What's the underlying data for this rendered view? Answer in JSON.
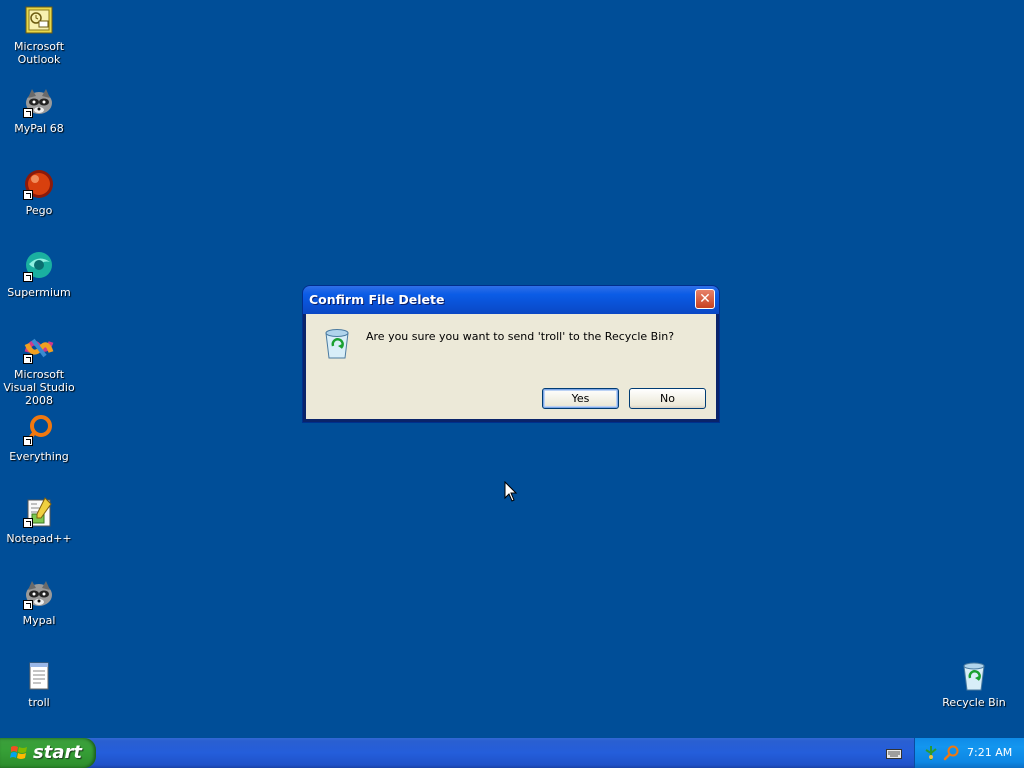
{
  "desktop": {
    "icons": [
      {
        "label": "Microsoft Outlook",
        "icon": "outlook-icon"
      },
      {
        "label": "MyPal 68",
        "icon": "mypal-raccoon-icon"
      },
      {
        "label": "Pego",
        "icon": "pego-icon"
      },
      {
        "label": "Supermium",
        "icon": "supermium-icon"
      },
      {
        "label": "Microsoft Visual Studio 2008",
        "icon": "visual-studio-icon"
      },
      {
        "label": "Everything",
        "icon": "everything-search-icon"
      },
      {
        "label": "Notepad++",
        "icon": "notepadpp-icon"
      },
      {
        "label": "Mypal",
        "icon": "mypal-raccoon-icon"
      },
      {
        "label": "troll",
        "icon": "text-file-icon"
      },
      {
        "label": "Recycle Bin",
        "icon": "recycle-bin-icon"
      }
    ]
  },
  "dialog": {
    "title": "Confirm File Delete",
    "message": "Are you sure you want to send 'troll' to the Recycle Bin?",
    "yes_label": "Yes",
    "no_label": "No",
    "close_glyph": "✕"
  },
  "taskbar": {
    "start_label": "start",
    "clock": "7:21 AM"
  },
  "colors": {
    "desktop": "#004e98",
    "taskbar": "#245edb",
    "start_button": "#37a037",
    "tray": "#1396ef"
  }
}
